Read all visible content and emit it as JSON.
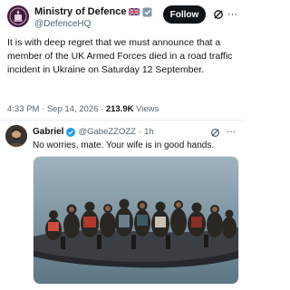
{
  "tweet": {
    "author_name": "Ministry of Defence",
    "author_handle": "@DefenceHQ",
    "follow_label": "Follow",
    "more_label": "···",
    "body": "It is with deep regret that we must announce that a member of the UK Armed Forces died in a road traffic incident in Ukraine on Saturday 12 September.",
    "time": "4:33 PM",
    "date": "Sep 14, 2026",
    "views_count": "213.9K",
    "views_label": "Views",
    "flag_icon": "uk-flag-icon",
    "grok_icon": "grok-icon"
  },
  "reply": {
    "author_name": "Gabriel",
    "author_handle": "@GabeZZOZZ",
    "age": "1h",
    "text": "No worries, mate. Your wife is in good hands.",
    "more_label": "···",
    "verified_color": "#1d9bf0",
    "media_icon": "photo-boat-crowd"
  },
  "colors": {
    "follow_bg": "#0f1419",
    "secondary_text": "#536471",
    "verified": "#1d9bf0"
  }
}
